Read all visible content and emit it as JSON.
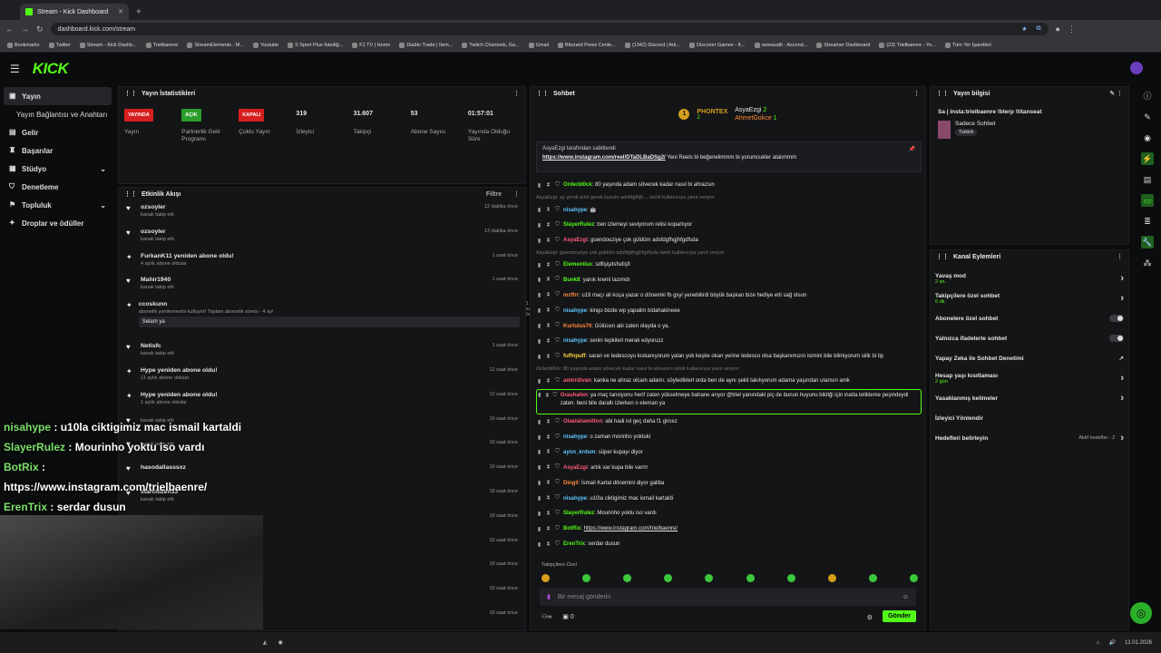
{
  "browser": {
    "tab_title": "Stream - Kick Dashboard",
    "url": "dashboard.kick.com/stream",
    "bookmarks": [
      "Bookmarks",
      "Twitter",
      "Stream - Kick Dashb...",
      "Trielbaenre",
      "StreamElements - M...",
      "Youtube",
      "S Sport Plus-İstediğ...",
      "F1 TV | Home",
      "Diablo Trade | Item...",
      "Twitch Channels, Ga...",
      "Gmail",
      "Blizzard Press Cente...",
      "(1342) Discord | Ark...",
      "Discover Games - K...",
      "wowaudit - Ascend...",
      "Streamer Dashboard",
      "(23) Trielbaenre - Yo...",
      "Tüm Yer İşaretleri"
    ]
  },
  "header": {
    "logo": "KICK"
  },
  "sidebar": {
    "items": [
      {
        "label": "Yayın",
        "icon": "video-icon"
      },
      {
        "label": "Yayın Bağlantısı ve Anahtarı"
      },
      {
        "label": "Gelir",
        "icon": "wallet-icon"
      },
      {
        "label": "Başarılar",
        "icon": "trophy-icon"
      },
      {
        "label": "Stüdyo",
        "icon": "studio-icon"
      },
      {
        "label": "Denetleme",
        "icon": "shield-icon"
      },
      {
        "label": "Topluluk",
        "icon": "community-icon"
      },
      {
        "label": "Droplar ve ödüller",
        "icon": "gift-icon"
      }
    ]
  },
  "stats": {
    "title": "Yayın İstatistikleri",
    "items": [
      {
        "value": "YAYINDA",
        "label": "Yayın",
        "kind": "badge-red"
      },
      {
        "value": "AÇIK",
        "label": "Partnerlik Gelir Programı",
        "kind": "badge-green"
      },
      {
        "value": "KAPALI",
        "label": "Çoklu Yayın",
        "kind": "badge-red"
      },
      {
        "value": "319",
        "label": "İzleyici"
      },
      {
        "value": "31.607",
        "label": "Takipçi"
      },
      {
        "value": "53",
        "label": "Abone Sayısı"
      },
      {
        "value": "01:57:01",
        "label": "Yayında Olduğu Süre"
      }
    ]
  },
  "activity": {
    "title": "Etkinlik Akışı",
    "filter": "Filtre",
    "items": [
      {
        "name": "ozsoyler",
        "sub": "kanalı takip etti",
        "time": "12 dakika önce",
        "icon": "heart"
      },
      {
        "name": "ozsoyler",
        "sub": "kanalı takip etti",
        "time": "13 dakika önce",
        "icon": "heart"
      },
      {
        "name": "FurkanK11 yeniden abone oldu!",
        "sub": "4 aylık abone oldular",
        "time": "1 saat önce",
        "icon": "star"
      },
      {
        "name": "Mahir1940",
        "sub": "kanalı takip etti",
        "time": "1 saat önce",
        "icon": "heart"
      },
      {
        "name": "ccoskunn",
        "sub": "abonelik yenilemesini kutluyor! Toplam abonelik süresi - 4 ay!",
        "time": "1 saat önce",
        "icon": "star",
        "message": "Selam ya"
      },
      {
        "name": "Netisfc",
        "sub": "kanalı takip etti",
        "time": "1 saat önce",
        "icon": "heart"
      },
      {
        "name": "Hype yeniden abone oldu!",
        "sub": "11 aylık abone oldular",
        "time": "12 saat önce",
        "icon": "star"
      },
      {
        "name": "Hype yeniden abone oldu!",
        "sub": "1 aylık abone oldular",
        "time": "12 saat önce",
        "icon": "star"
      },
      {
        "name": "",
        "sub": "kanalı takip etti",
        "time": "19 saat önce",
        "icon": "heart"
      },
      {
        "name": "",
        "sub": "kanalı takip etti",
        "time": "19 saat önce",
        "icon": "heart"
      },
      {
        "name": "hasodallasssxz",
        "sub": "",
        "time": "19 saat önce",
        "icon": "heart"
      },
      {
        "name": "starcitizen33",
        "sub": "kanalı takip etti",
        "time": "19 saat önce",
        "icon": "heart"
      },
      {
        "name": "",
        "sub": "",
        "time": "19 saat önce",
        "icon": ""
      },
      {
        "name": "",
        "sub": "",
        "time": "19 saat önce",
        "icon": ""
      },
      {
        "name": "",
        "sub": "",
        "time": "19 saat önce",
        "icon": ""
      },
      {
        "name": "",
        "sub": "",
        "time": "19 saat önce",
        "icon": ""
      },
      {
        "name": "",
        "sub": "",
        "time": "19 saat önce",
        "icon": ""
      }
    ]
  },
  "chat": {
    "title": "Sohbet",
    "top": {
      "leader": "PHONTEX",
      "leader_count": "2",
      "u1": "AsyaEzgi",
      "u1_count": "2",
      "u2": "AhmetGokce",
      "u2_count": "1"
    },
    "pinned_by": "AsyaEzgi tarafından sabitlendi",
    "pinned_link": "https://www.instagram.com/reel/DTaDLBaDSg2/",
    "pinned_text": "Yeni Reels bi beğenelimmm bi yorumcukler atalımmm",
    "lines": [
      {
        "user": "Orderbl0ck",
        "color": "#53fc18",
        "text": "80 yaşında adam sövecek kadar nasıl bi ahrazsın"
      },
      {
        "note": "AsyaEzgi: ay şimdi artık gerek kuzum adsfdgfhjh… isimli kullanıcıya yanıt veriyor"
      },
      {
        "user": "nisahype",
        "color": "#5ec8ff",
        "text": "🤖"
      },
      {
        "user": "SlayerRulez",
        "color": "#53fc18",
        "text": "ben izlemeyi seviyorum relisi kopartıyor"
      },
      {
        "user": "AsyaEzgi",
        "color": "#ff5b7a",
        "text": "guendouziye çok güldüm adsfdgfhgjhfgdfsda"
      },
      {
        "note": "AsyaEzgi: guendouziye çok güldüm adsfdgfhgjhfgdfsda isimli kullanıcıya yanıt veriyor"
      },
      {
        "user": "Elementiux",
        "color": "#53fc18",
        "text": "sdfişişdsfsdişfi"
      },
      {
        "user": "Bunk8",
        "color": "#53fc18",
        "text": "yanık kremi lazımdı"
      },
      {
        "user": "mzffrr",
        "color": "#ff8a3d",
        "text": "u19 maçı ali koça yazar o dönemki fb gsyi yenebilirdi büyük başkan bize hediye etti sağ olsun"
      },
      {
        "user": "nisahype",
        "color": "#5ec8ff",
        "text": "kingo bizde wp yapalim bidahakineee"
      },
      {
        "user": "Kurtulus70",
        "color": "#ff8a3d",
        "text": "Gülücen abi zaten olayda o ya."
      },
      {
        "user": "nisahype",
        "color": "#5ec8ff",
        "text": "senin tepkileri merak edyoruzz"
      },
      {
        "user": "fuffnpuff",
        "color": "#ffd23d",
        "text": "saran ve tedescoyu kıskanıyorum yalan yok keşke okan yerine tedesco olsa başkanımızın isimini bile bilmiyorum silik bi tip"
      },
      {
        "note": "Orderbl0ck: 80 yaşında adam sövecek kadar nasıl bi ahrazsın isimli kullanıcıya yanıt veriyor"
      },
      {
        "user": "amirrdivan",
        "color": "#ff5b7a",
        "text": "kanka ne ahraz olcam adamı. söylediklerl orda ben de aynı şekil takılıyorum adama yaşından utansın amk"
      },
      {
        "user": "Grauhafen",
        "color": "#ff5b7a",
        "text": "ya maç tansiyonu herif zaten yükselmeye bahane arıyor @triel yanındaki piç de bunun huyunu bildiği için inatla tetikleme peşindeydi zaten. beni bile daraltı izlerken o eleman ya",
        "highlight": true
      },
      {
        "user": "Olaelahamilton",
        "color": "#ff5b7a",
        "text": "abi hadi iol geç daha f1 gircez"
      },
      {
        "user": "nisahype",
        "color": "#5ec8ff",
        "text": "o zaman morinho yoktuki"
      },
      {
        "user": "aynn_krdsm",
        "color": "#5ec8ff",
        "text": "süper kupayı diyor"
      },
      {
        "user": "AsyaEzgi",
        "color": "#ff5b7a",
        "text": "artık var kupa bile varrrr"
      },
      {
        "user": "Dingil",
        "color": "#ff8a3d",
        "text": "İsmail Kartal dönemini diyor galiba"
      },
      {
        "user": "nisahype",
        "color": "#5ec8ff",
        "text": "u10la ciktigimiz mac ismail kartaldi"
      },
      {
        "user": "SlayerRulez",
        "color": "#53fc18",
        "text": "Mourinho yoktu iso vardı"
      },
      {
        "user": "BotRix",
        "color": "#53fc18",
        "text": "https://www.instagram.com/trielbaenre/"
      },
      {
        "user": "ErenTrix",
        "color": "#53fc18",
        "text": "serdar dusun"
      }
    ],
    "followers_only": "Takipçilere Özel",
    "input_placeholder": "Bir mesaj gönderin",
    "send": "Gönder",
    "count": "0"
  },
  "info": {
    "title": "Yayın bilgisi",
    "stream_title": "Sa | insta:trielbaenre !blerp !titanseat",
    "category": "Sadece Sohbet",
    "tag": "Türkish"
  },
  "actions": {
    "title": "Kanal Eylemleri",
    "items": [
      {
        "label": "Yavaş mod",
        "sub": "2 sn.",
        "right": "chevron"
      },
      {
        "label": "Takipçilere özel sohbet",
        "sub": "6 dk.",
        "right": "chevron"
      },
      {
        "label": "Abonelere özel sohbet",
        "right": "toggle"
      },
      {
        "label": "Yalnızca ifadelerle sohbet",
        "right": "toggle"
      },
      {
        "label": "Yapay Zeka ile Sohbet Denetimi",
        "right": "external"
      },
      {
        "label": "Hesap yaşı kısıtlaması",
        "sub": "2 gün",
        "right": "chevron"
      },
      {
        "label": "Yasaklanmış kelimeler",
        "right": "chevron"
      },
      {
        "label": "İzleyici Yönlendir",
        "right": ""
      },
      {
        "label": "Hedefleri belirleyin",
        "right_text": "Aktif hedefler - 2",
        "right": "chevron"
      }
    ]
  },
  "overlay": {
    "lines": [
      {
        "user": "nisahype",
        "text": ": u10la ciktigimiz mac ismail kartaldi"
      },
      {
        "user": "SlayerRulez",
        "text": ": Mourinho yoktu iso vardı"
      },
      {
        "user": "BotRix",
        "text": ":"
      },
      {
        "user": "",
        "text": "https://www.instagram.com/trielbaenre/"
      },
      {
        "user": "ErenTrix",
        "text": ": serdar dusun"
      }
    ]
  },
  "taskbar": {
    "time": "12.01.2026"
  },
  "colors": {
    "accent": "#53fc18",
    "panel": "#141517",
    "live": "#d61f1f"
  }
}
